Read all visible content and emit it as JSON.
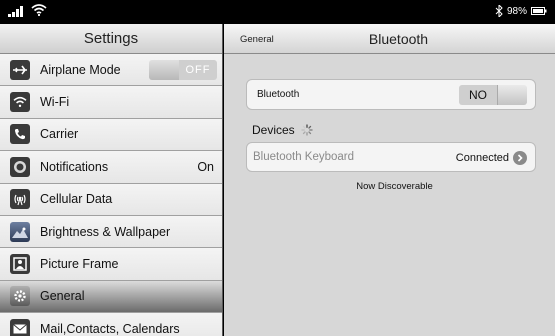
{
  "status_bar": {
    "battery_percent": "98%",
    "icons": [
      "signal-icon",
      "wifi-icon",
      "bluetooth-icon",
      "battery-icon"
    ]
  },
  "sidebar": {
    "title": "Settings",
    "items": [
      {
        "label": "Airplane Mode",
        "icon": "airplane-icon",
        "toggle": "OFF"
      },
      {
        "label": "Wi-Fi",
        "icon": "wifi-icon"
      },
      {
        "label": "Carrier",
        "icon": "phone-icon"
      },
      {
        "label": "Notifications",
        "icon": "notifications-icon",
        "value": "On"
      },
      {
        "label": "Cellular Data",
        "icon": "antenna-icon"
      },
      {
        "label": "Brightness & Wallpaper",
        "icon": "wallpaper-icon"
      },
      {
        "label": "Picture Frame",
        "icon": "picture-frame-icon"
      },
      {
        "label": "General",
        "icon": "gear-icon",
        "selected": true
      },
      {
        "label": "Mail,Contacts, Calendars",
        "icon": "mail-icon"
      }
    ]
  },
  "detail": {
    "back_label": "General",
    "title": "Bluetooth",
    "bluetooth_row": {
      "label": "Bluetooth",
      "toggle": "NO"
    },
    "devices_label": "Devices",
    "device": {
      "name": "Bluetooth  Keyboard",
      "status": "Connected"
    },
    "discoverable_text": "Now Discoverable"
  },
  "colors": {
    "sidebar_bg": "#c6c6c6",
    "detail_bg": "#d7d7d7",
    "status_bar_bg": "#000000"
  }
}
